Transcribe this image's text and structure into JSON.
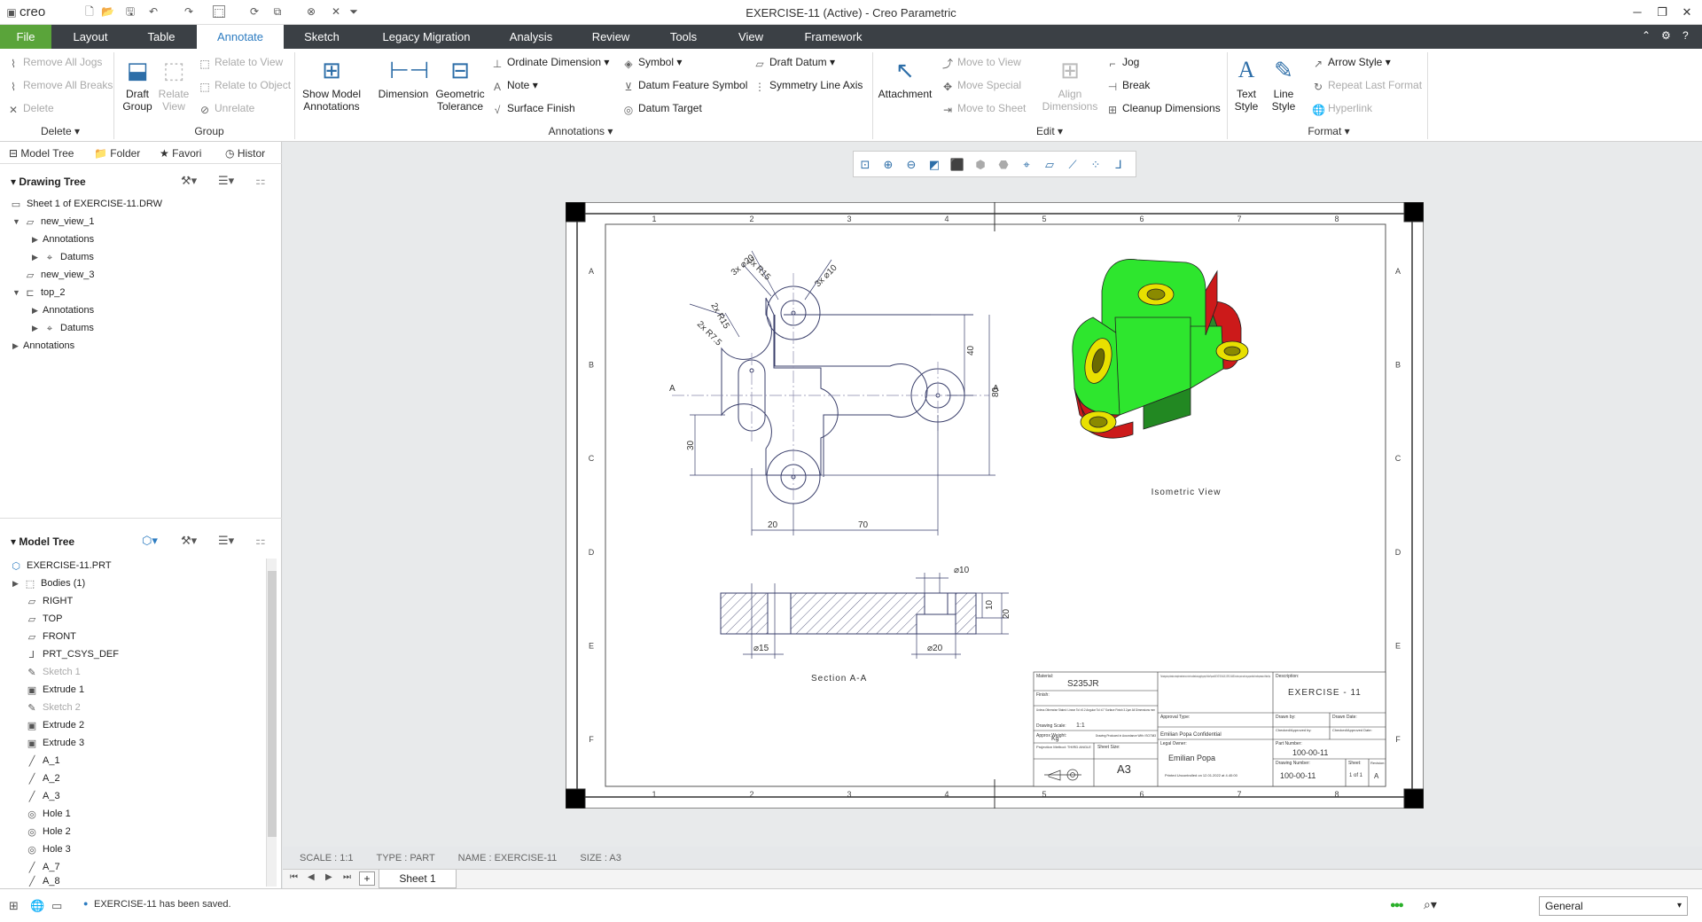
{
  "app": {
    "name": "creo",
    "title": "EXERCISE-11 (Active) - Creo Parametric"
  },
  "window": {
    "minimize": "─",
    "maximize": "❐",
    "close": "✕"
  },
  "menu": {
    "tabs": [
      "File",
      "Layout",
      "Table",
      "Annotate",
      "Sketch",
      "Legacy Migration",
      "Analysis",
      "Review",
      "Tools",
      "View",
      "Framework"
    ],
    "active": "Annotate"
  },
  "ribbon": {
    "delete_group": {
      "remove_all_jogs": "Remove All Jogs",
      "remove_all_breaks": "Remove All Breaks",
      "delete": "Delete",
      "label": "Delete"
    },
    "group_group": {
      "draft_group": "Draft Group",
      "relate_view": "Relate View",
      "relate_to_view": "Relate to View",
      "relate_to_object": "Relate to Object",
      "unrelate": "Unrelate",
      "label": "Group"
    },
    "annotations_group": {
      "show_model_annotations": "Show Model Annotations",
      "dimension": "Dimension",
      "geometric_tolerance": "Geometric Tolerance",
      "ordinate_dimension": "Ordinate Dimension",
      "note": "Note",
      "surface_finish": "Surface Finish",
      "symbol": "Symbol",
      "datum_feature_symbol": "Datum Feature Symbol",
      "datum_target": "Datum Target",
      "draft_datum": "Draft Datum",
      "symmetry_line_axis": "Symmetry Line Axis",
      "label": "Annotations"
    },
    "edit_group": {
      "attachment": "Attachment",
      "move_to_view": "Move to View",
      "move_special": "Move Special",
      "move_to_sheet": "Move to Sheet",
      "align_dimensions": "Align Dimensions",
      "jog": "Jog",
      "break": "Break",
      "cleanup_dimensions": "Cleanup Dimensions",
      "label": "Edit"
    },
    "format_group": {
      "text_style": "Text Style",
      "line_style": "Line Style",
      "arrow_style": "Arrow Style",
      "repeat_last_format": "Repeat Last Format",
      "hyperlink": "Hyperlink",
      "label": "Format"
    }
  },
  "left_panel": {
    "tabs": [
      "Model Tree",
      "Folder",
      "Favori",
      "Histor"
    ],
    "drawing_tree": {
      "title": "Drawing Tree",
      "nodes": [
        "Sheet 1 of EXERCISE-11.DRW",
        "new_view_1",
        "Annotations",
        "Datums",
        "new_view_3",
        "top_2",
        "Annotations",
        "Datums",
        "Annotations"
      ]
    },
    "model_tree": {
      "title": "Model Tree",
      "nodes": [
        "EXERCISE-11.PRT",
        "Bodies (1)",
        "RIGHT",
        "TOP",
        "FRONT",
        "PRT_CSYS_DEF",
        "Sketch 1",
        "Extrude 1",
        "Sketch 2",
        "Extrude 2",
        "Extrude 3",
        "A_1",
        "A_2",
        "A_3",
        "Hole 1",
        "Hole 2",
        "Hole 3",
        "A_7",
        "A_8"
      ]
    }
  },
  "drawing": {
    "border_cols": [
      "1",
      "2",
      "3",
      "4",
      "5",
      "6",
      "7",
      "8"
    ],
    "border_rows": [
      "A",
      "B",
      "C",
      "D",
      "E",
      "F"
    ],
    "dims": {
      "r15_top": "3x R15",
      "d20_top": "3x ⌀20",
      "d10_top": "3x ⌀10",
      "r15_side": "2x R15",
      "r7_5": "2x R7.5",
      "h40": "40",
      "h80": "80",
      "h30": "30",
      "w20": "20",
      "w70": "70",
      "sec_d10": "⌀10",
      "sec_10": "10",
      "sec_20": "20",
      "sec_d15": "⌀15",
      "sec_d20": "⌀20",
      "cut_a": "A"
    },
    "iso_label": "Isometric View",
    "section_label": "Section A-A",
    "title_block": {
      "material_lbl": "Material:",
      "material": "S235JR",
      "finish_lbl": "Finish:",
      "tolerance": "Unless Otherwise Stated: Linear Tol ±0.2 Angular Tol ±1° Surface Finish 3.2µm All Dimensions mm",
      "drawing_scale_lbl": "Drawing Scale:",
      "drawing_scale": "1:1",
      "approx_weight_lbl": "Approx Weight:",
      "approx_weight": "Kg",
      "produced_by": "Drawing Produced in Accordance With: ISO7083",
      "projection_lbl": "Projection Method: THIRD ANGLE",
      "sheet_size_lbl": "Sheet Size:",
      "sheet_size": "A3",
      "confidential_note": "This drawing and any information or descriptive material set out on it are the confidential and copyright property of Emilian Popa and MUST NOT BE DIVULGED, COPIED, CHANGED in whole or part or used for any purpose without the written permission of Emilian Popa",
      "approval_type_lbl": "Approval Type:",
      "confidential": "Emilian Popa Confidential",
      "legal_owner_lbl": "Legal Owner:",
      "owner": "Emilian Popa",
      "printed_note": "Printed Uncontrolled on 12.01.2022 at 4.40:00",
      "description_lbl": "Description:",
      "description": "EXERCISE - 11",
      "drawn_by_lbl": "Drawn by:",
      "drawn_date_lbl": "Drawn Date:",
      "checked_by_lbl": "Checked/Approved by:",
      "checked_date_lbl": "Checked/Approved Date:",
      "part_number_lbl": "Part Number:",
      "part_number": "100-00-11",
      "drawing_number_lbl": "Drawing Number:",
      "drawing_number": "100-00-11",
      "sheet_lbl": "Sheet:",
      "sheet": "1 of 1",
      "revision_lbl": "Revision:",
      "revision": "A"
    }
  },
  "status_info": {
    "scale": "SCALE : 1:1",
    "type": "TYPE : PART",
    "name": "NAME : EXERCISE-11",
    "size": "SIZE : A3"
  },
  "sheet_tabs": {
    "current": "Sheet 1",
    "add": "+"
  },
  "status_bar": {
    "message": "EXERCISE-11 has been saved.",
    "filter": "General"
  },
  "colors": {
    "accent": "#2d7cc1",
    "file_tab": "#5aa43a",
    "menubar": "#3b4045",
    "iso_green": "#2ee62e",
    "iso_red": "#d61a1a",
    "iso_yellow": "#e8e000",
    "drawing_line": "#3a3f6b"
  }
}
